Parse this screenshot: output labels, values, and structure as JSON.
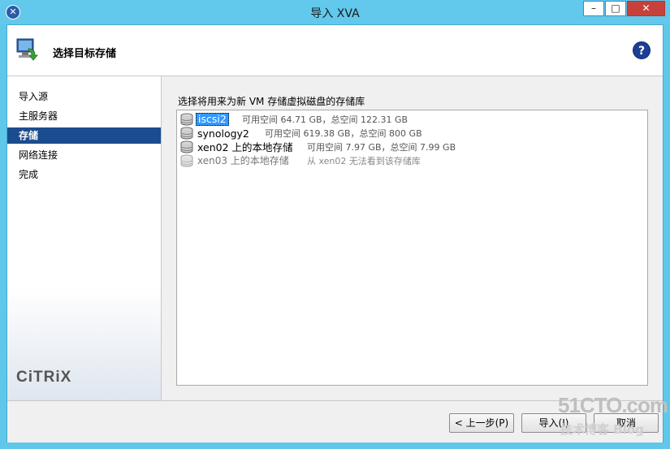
{
  "window": {
    "title": "导入 XVA",
    "minimize": "–",
    "maximize": "□",
    "close": "✕"
  },
  "header": {
    "title": "选择目标存储",
    "help": "?"
  },
  "sidebar": {
    "items": [
      {
        "label": "导入源"
      },
      {
        "label": "主服务器"
      },
      {
        "label": "存储"
      },
      {
        "label": "网络连接"
      },
      {
        "label": "完成"
      }
    ],
    "active_index": 2,
    "logo_text": "CiTRiX"
  },
  "content": {
    "prompt": "选择将用来为新 VM 存储虚拟磁盘的存储库",
    "storage_repositories": [
      {
        "name": "iscsi2",
        "detail": "可用空间 64.71 GB，总空间 122.31 GB",
        "selected": true,
        "enabled": true
      },
      {
        "name": "synology2",
        "detail": "可用空间 619.38 GB，总空间 800 GB",
        "selected": false,
        "enabled": true
      },
      {
        "name": "xen02 上的本地存储",
        "detail": "可用空间 7.97 GB，总空间 7.99 GB",
        "selected": false,
        "enabled": true
      },
      {
        "name": "xen03 上的本地存储",
        "detail": "从 xen02 无法看到该存储库",
        "selected": false,
        "enabled": false
      }
    ]
  },
  "footer": {
    "back": "< 上一步(P)",
    "import": "导入(I)",
    "cancel": "取消"
  },
  "watermark": {
    "line1": "51CTO.com",
    "line2": "技术博客 Blog"
  },
  "colors": {
    "titlebar": "#62c8ec",
    "selection": "#3399ff",
    "nav_active": "#1b4c8f",
    "close": "#c7413a"
  }
}
